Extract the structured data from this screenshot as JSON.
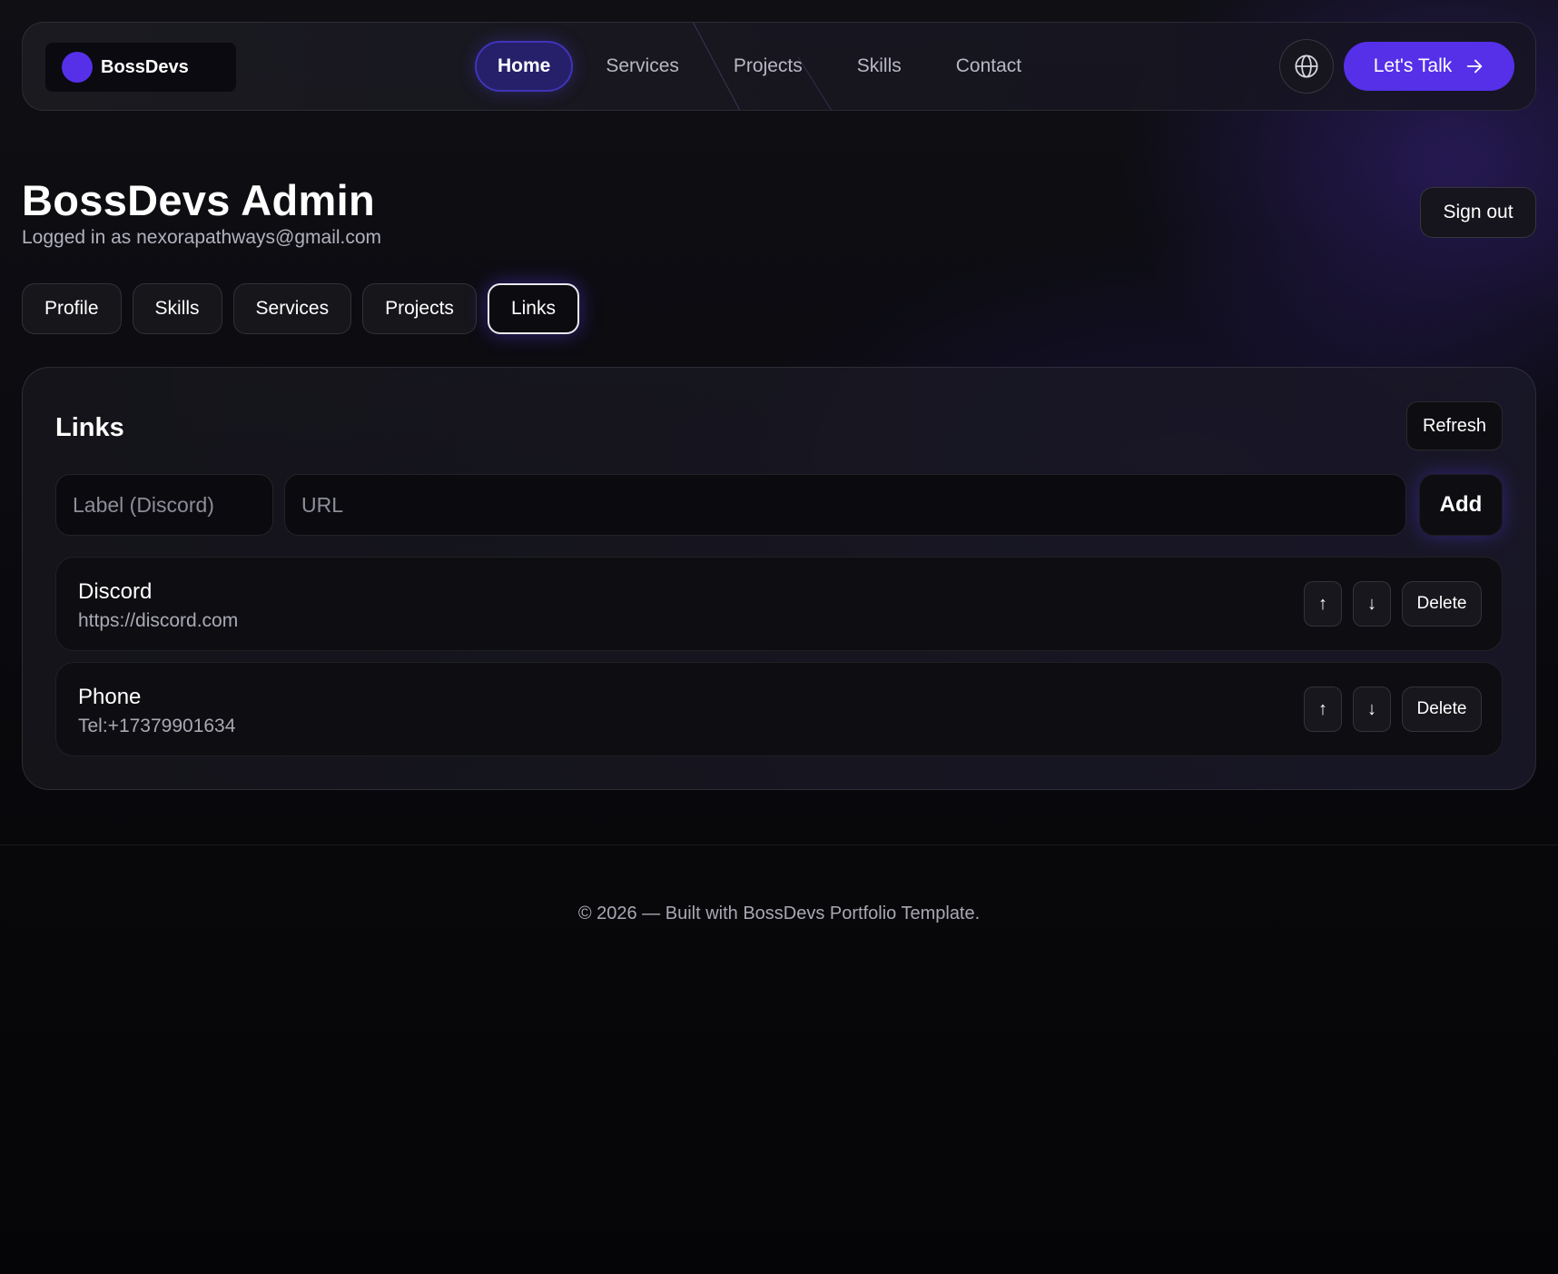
{
  "nav": {
    "brand": "BossDevs",
    "links": [
      {
        "label": "Home",
        "active": true
      },
      {
        "label": "Services",
        "active": false
      },
      {
        "label": "Projects",
        "active": false
      },
      {
        "label": "Skills",
        "active": false
      },
      {
        "label": "Contact",
        "active": false
      }
    ],
    "cta_label": "Let's Talk",
    "language_icon": "globe-icon",
    "cta_icon": "arrow-right-icon"
  },
  "header": {
    "title": "BossDevs Admin",
    "logged_in_text": "Logged in as nexorapathways@gmail.com",
    "sign_out_label": "Sign out"
  },
  "tabs": [
    {
      "label": "Profile",
      "active": false
    },
    {
      "label": "Skills",
      "active": false
    },
    {
      "label": "Services",
      "active": false
    },
    {
      "label": "Projects",
      "active": false
    },
    {
      "label": "Links",
      "active": true
    }
  ],
  "links_panel": {
    "title": "Links",
    "refresh_label": "Refresh",
    "label_placeholder": "Label (Discord)",
    "url_placeholder": "URL",
    "add_label": "Add",
    "items": [
      {
        "label": "Discord",
        "url": "https://discord.com",
        "up": "↑",
        "down": "↓",
        "delete": "Delete"
      },
      {
        "label": "Phone",
        "url": "Tel:+17379901634",
        "up": "↑",
        "down": "↓",
        "delete": "Delete"
      }
    ]
  },
  "footer": {
    "text": "© 2026 — Built with BossDevs Portfolio Template."
  },
  "colors": {
    "accent": "#5530e8",
    "active_nav_bg": "#26206a",
    "background": "#070709"
  }
}
